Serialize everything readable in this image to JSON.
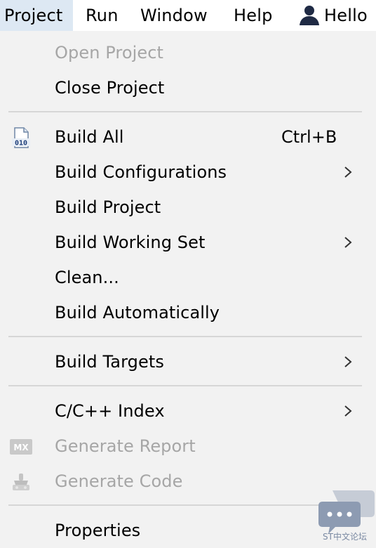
{
  "menubar": {
    "items": [
      {
        "label": "Project"
      },
      {
        "label": "Run"
      },
      {
        "label": "Window"
      },
      {
        "label": "Help"
      },
      {
        "label": "Hello"
      }
    ]
  },
  "menu": {
    "open_project": "Open Project",
    "close_project": "Close Project",
    "build_all": "Build All",
    "build_all_shortcut": "Ctrl+B",
    "build_configurations": "Build Configurations",
    "build_project": "Build Project",
    "build_working_set": "Build Working Set",
    "clean": "Clean...",
    "build_automatically": "Build Automatically",
    "build_targets": "Build Targets",
    "cc_index": "C/C++ Index",
    "generate_report": "Generate Report",
    "generate_code": "Generate Code",
    "properties": "Properties"
  },
  "icons": {
    "build_all": "binary-file-icon",
    "generate_report": "mx-icon",
    "generate_code": "generate-code-icon",
    "user": "user-icon",
    "submenu": "chevron-right-icon"
  },
  "watermark": {
    "text": "ST中文论坛"
  },
  "colors": {
    "menu_bg": "#f2f2f2",
    "selected_menu_bg": "#dde8f3",
    "disabled_text": "#a6a6a6",
    "separator": "#d6d6d6"
  }
}
